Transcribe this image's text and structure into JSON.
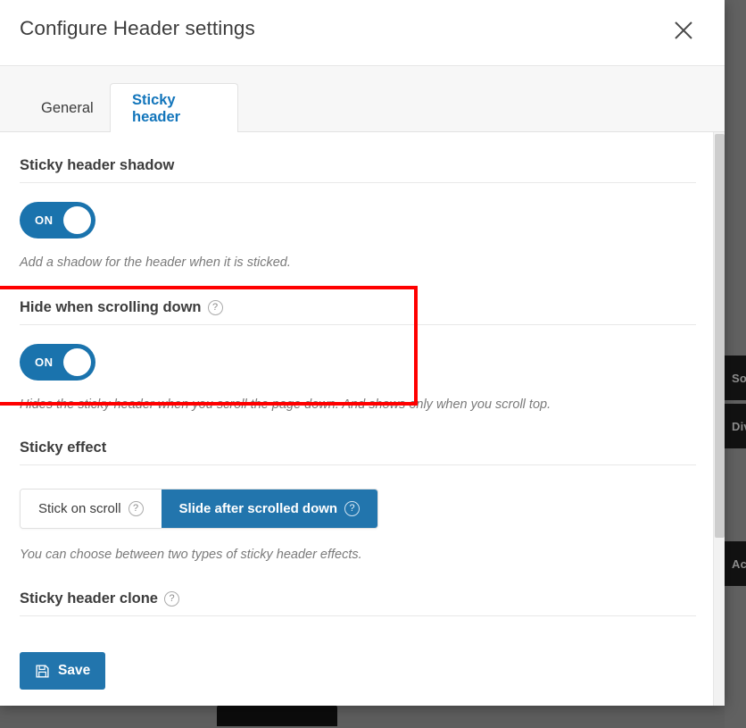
{
  "modal": {
    "title": "Configure Header settings",
    "close_icon": "close-icon"
  },
  "tabs": [
    {
      "label": "General",
      "active": false
    },
    {
      "label": "Sticky header",
      "active": true
    }
  ],
  "sections": {
    "shadow": {
      "title": "Sticky header shadow",
      "toggle_label": "ON",
      "toggle_state": "on",
      "description": "Add a shadow for the header when it is sticked."
    },
    "hide_scroll": {
      "title": "Hide when scrolling down",
      "help_icon": "question-mark-icon",
      "toggle_label": "ON",
      "toggle_state": "on",
      "description": "Hides the sticky header when you scroll the page down. And shows only when you scroll top."
    },
    "sticky_effect": {
      "title": "Sticky effect",
      "options": [
        {
          "label": "Stick on scroll",
          "selected": false,
          "help_icon": "question-mark-icon"
        },
        {
          "label": "Slide after scrolled down",
          "selected": true,
          "help_icon": "question-mark-icon"
        }
      ],
      "description": "You can choose between two types of sticky header effects."
    },
    "clone": {
      "title": "Sticky header clone",
      "help_icon": "question-mark-icon"
    }
  },
  "footer": {
    "save_label": "Save",
    "save_icon": "floppy-disk-icon"
  },
  "background": {
    "widgets": [
      {
        "label": "Soc"
      },
      {
        "label": "Div"
      },
      {
        "label": "Acc"
      }
    ]
  },
  "annotation": {
    "color": "#ff0000",
    "shape": "rectangle"
  },
  "colors": {
    "accent": "#2275ad",
    "toggle_on": "#1a73ad",
    "tab_active_text": "#1275bb",
    "annotation": "#ff0000"
  }
}
